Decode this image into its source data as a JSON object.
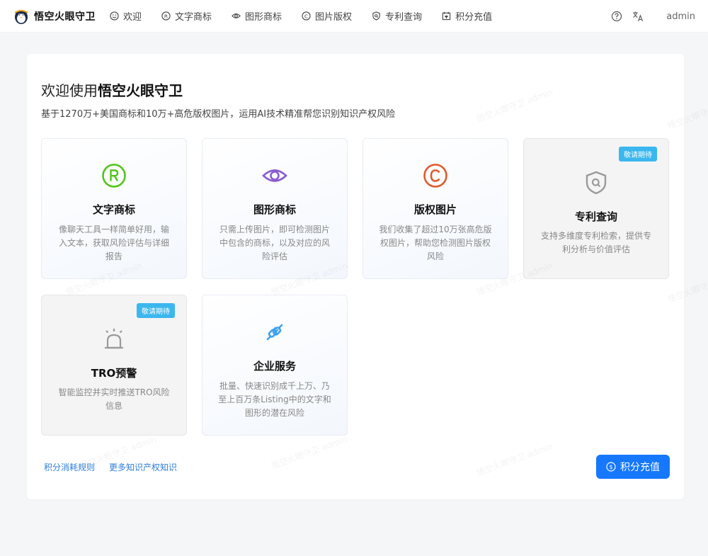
{
  "app": {
    "title": "悟空火眼守卫"
  },
  "nav": {
    "items": [
      {
        "label": "欢迎",
        "icon": "smile-icon"
      },
      {
        "label": "文字商标",
        "icon": "registered-icon"
      },
      {
        "label": "图形商标",
        "icon": "eye-icon"
      },
      {
        "label": "图片版权",
        "icon": "copyright-icon"
      },
      {
        "label": "专利查询",
        "icon": "shield-search-icon"
      },
      {
        "label": "积分充值",
        "icon": "calendar-icon"
      }
    ],
    "help_icon": "question-circle-icon",
    "lang_icon": "translate-icon",
    "user": "admin"
  },
  "main": {
    "heading_prefix": "欢迎使用",
    "heading_brand": "悟空火眼守卫",
    "subtitle": "基于1270万+美国商标和10万+高危版权图片，运用AI技术精准帮您识别知识产权风险",
    "tiles": [
      {
        "name": "文字商标",
        "desc": "像聊天工具一样简单好用，输入文本，获取风险评估与详细报告",
        "icon": "registered-icon",
        "color": "#52c41a"
      },
      {
        "name": "图形商标",
        "desc": "只需上传图片，即可检测图片中包含的商标，以及对应的风险评估",
        "icon": "eye-icon",
        "color": "#8a5cd0"
      },
      {
        "name": "版权图片",
        "desc": "我们收集了超过10万张高危版权图片，帮助您检测图片版权风险",
        "icon": "copyright-icon",
        "color": "#e05a2b"
      },
      {
        "name": "专利查询",
        "desc": "支持多维度专利检索，提供专利分析与价值评估",
        "icon": "shield-search-icon",
        "color": "#9a9a9a",
        "badge": "敬请期待"
      },
      {
        "name": "TRO预警",
        "desc": "智能监控并实时推送TRO风险信息",
        "icon": "alarm-icon",
        "color": "#9a9a9a",
        "badge": "敬请期待"
      },
      {
        "name": "企业服务",
        "desc": "批量、快速识别成千上万、乃至上百万条Listing中的文字和图形的潜在风险",
        "icon": "plug-icon",
        "color": "#3aa0f0"
      }
    ],
    "links": [
      "积分消耗规则",
      "更多知识产权知识"
    ],
    "recharge_label": "积分充值",
    "watermark": "悟空火眼守卫 admin"
  }
}
